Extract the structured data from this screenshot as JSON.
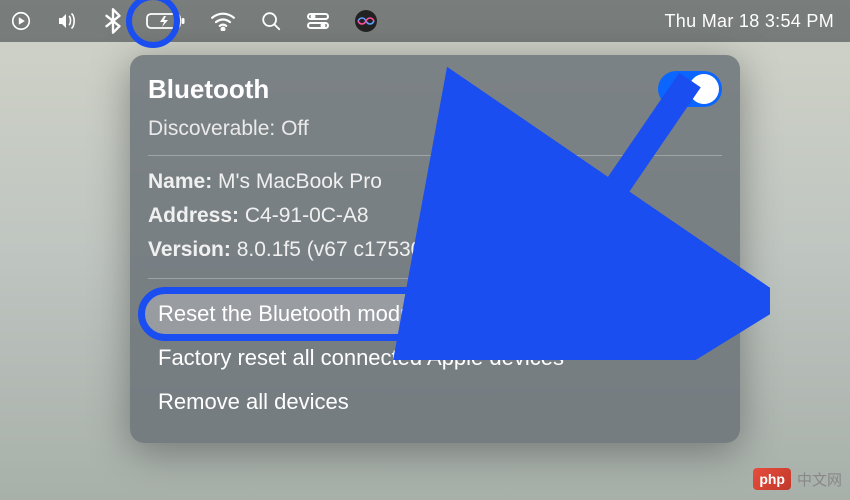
{
  "menubar": {
    "datetime": "Thu Mar 18  3:54 PM"
  },
  "panel": {
    "title": "Bluetooth",
    "discoverable_label": "Discoverable:",
    "discoverable_value": "Off",
    "toggle_on": true,
    "info": {
      "name_label": "Name:",
      "name_value": "M's MacBook Pro",
      "address_label": "Address:",
      "address_value": "C4-91-0C-A8",
      "version_label": "Version:",
      "version_value": "8.0.1f5 (v67 c17530)"
    },
    "actions": {
      "reset": "Reset the Bluetooth module",
      "factory_reset": "Factory reset all connected Apple devices",
      "remove_all": "Remove all devices"
    }
  },
  "watermark": {
    "logo": "php",
    "text": "中文网"
  }
}
